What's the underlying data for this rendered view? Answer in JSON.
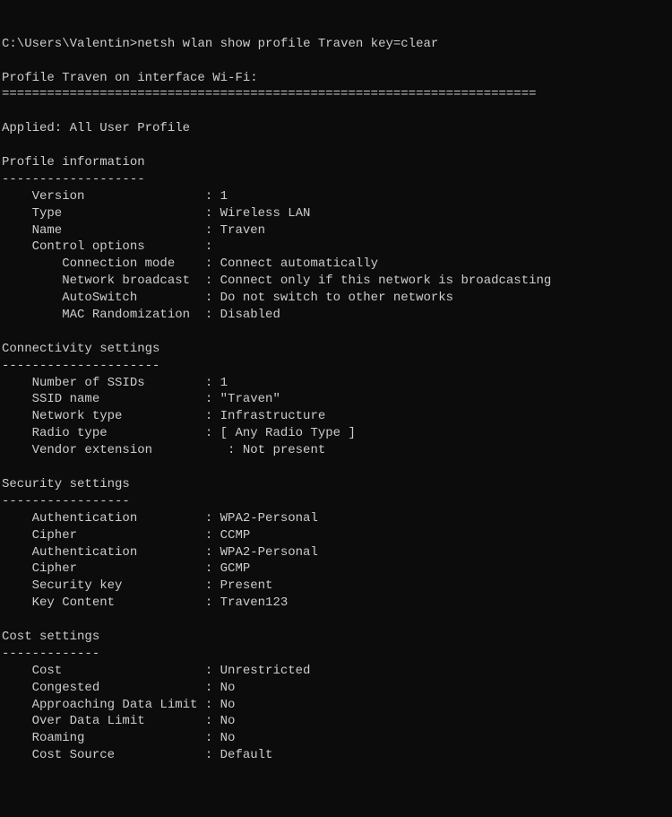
{
  "prompt": "C:\\Users\\Valentin>",
  "command": "netsh wlan show profile Traven key=clear",
  "blank": "",
  "profile_header": "Profile Traven on interface Wi-Fi:",
  "equals_divider": "=======================================================================",
  "applied": "Applied: All User Profile",
  "profile_info_header": "Profile information",
  "dash19": "-------------------",
  "dash21": "---------------------",
  "dash17": "-----------------",
  "dash13": "-------------",
  "pi": {
    "version": "    Version                : 1",
    "type": "    Type                   : Wireless LAN",
    "name": "    Name                   : Traven",
    "control_options": "    Control options        :",
    "connection_mode": "        Connection mode    : Connect automatically",
    "network_broadcast": "        Network broadcast  : Connect only if this network is broadcasting",
    "autoswitch": "        AutoSwitch         : Do not switch to other networks",
    "mac_randomization": "        MAC Randomization  : Disabled"
  },
  "conn_header": "Connectivity settings",
  "conn": {
    "num_ssids": "    Number of SSIDs        : 1",
    "ssid_name": "    SSID name              : \"Traven\"",
    "network_type": "    Network type           : Infrastructure",
    "radio_type": "    Radio type             : [ Any Radio Type ]",
    "vendor_extension": "    Vendor extension          : Not present"
  },
  "sec_header": "Security settings",
  "sec": {
    "auth1": "    Authentication         : WPA2-Personal",
    "cipher1": "    Cipher                 : CCMP",
    "auth2": "    Authentication         : WPA2-Personal",
    "cipher2": "    Cipher                 : GCMP",
    "seckey": "    Security key           : Present",
    "keycont": "    Key Content            : Traven123"
  },
  "cost_header": "Cost settings",
  "cost": {
    "cost": "    Cost                   : Unrestricted",
    "congested": "    Congested              : No",
    "approaching": "    Approaching Data Limit : No",
    "over": "    Over Data Limit        : No",
    "roaming": "    Roaming                : No",
    "source": "    Cost Source            : Default"
  }
}
